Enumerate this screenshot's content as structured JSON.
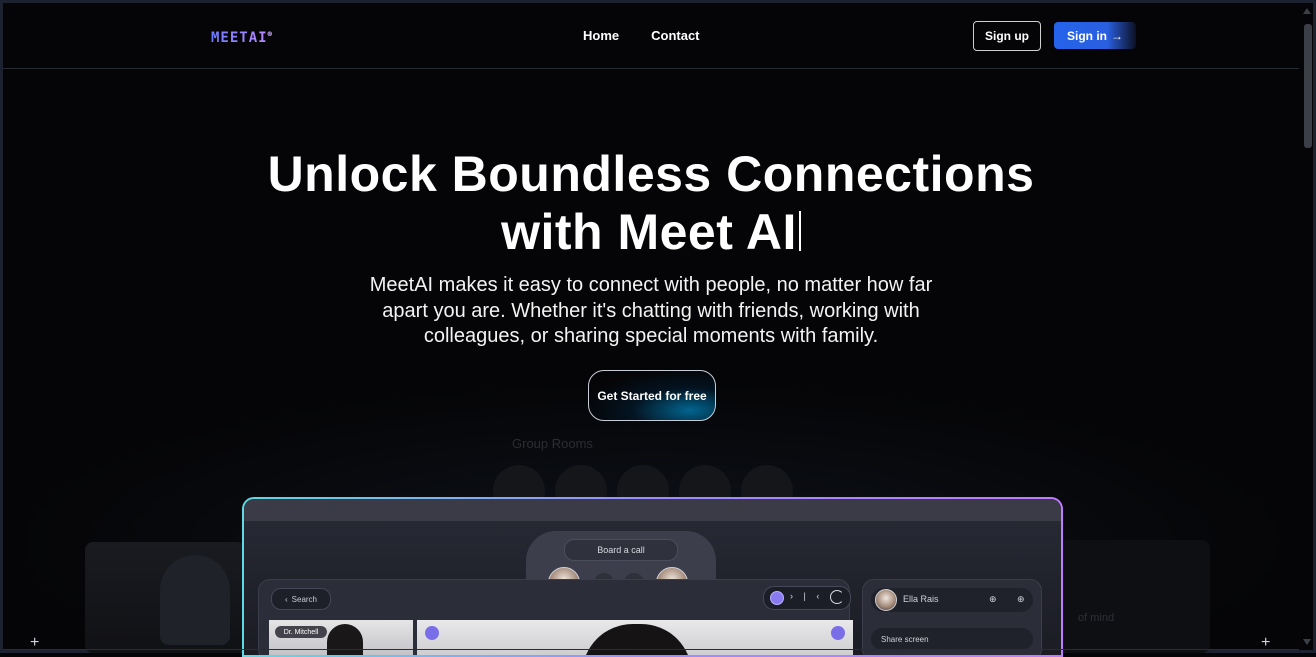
{
  "nav": {
    "logo": "MEETAI",
    "logo_mark": "®",
    "links": [
      "Home",
      "Contact"
    ],
    "sign_up": "Sign up",
    "sign_in": "Sign in",
    "sign_in_arrow": "→"
  },
  "hero": {
    "title_line1": "Unlock Boundless Connections",
    "title_line2": "with Meet AI",
    "subtitle": "MeetAI makes it easy to connect with people, no matter how far apart you are. Whether it's chatting with friends, working with colleagues, or sharing special moments with family.",
    "cta": "Get Started for free"
  },
  "background": {
    "ghost_title": "Group Rooms",
    "right_text_1": "of mind",
    "right_text_2": "",
    "plus_left": "+",
    "plus_right": "+"
  },
  "mockup": {
    "dock_label": "Board a call",
    "search_label": "Search",
    "controls_text": "› | ‹",
    "video_tag": "Dr. Mitchell",
    "contact_name": "Ella Rais",
    "row2_label": "Share screen",
    "icon_a": "⟲",
    "icon_b": "⌂"
  },
  "colors": {
    "background": "#050507",
    "accent_blue": "#2563eb",
    "gradient_start": "#5fd9e2",
    "gradient_end": "#c07cff"
  }
}
